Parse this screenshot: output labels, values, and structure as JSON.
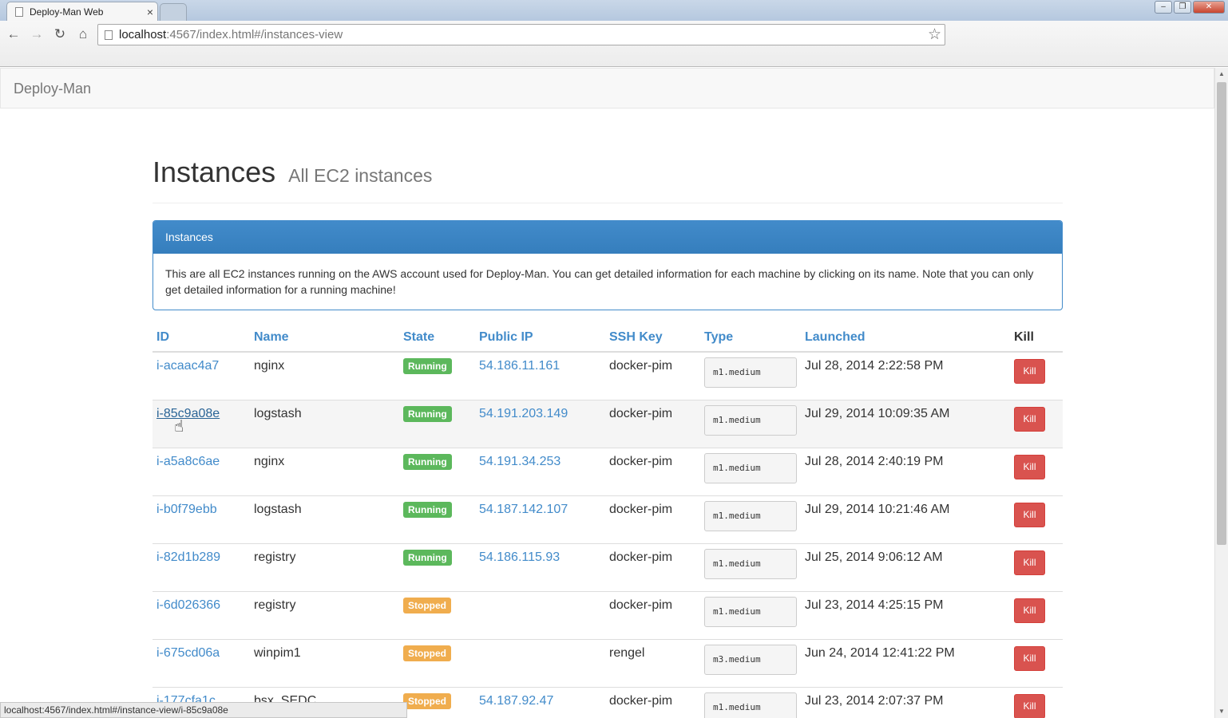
{
  "browser": {
    "tab_title": "Deploy-Man Web",
    "tab_close": "×",
    "url_host": "localhost",
    "url_rest": ":4567/index.html#/instances-view",
    "status_text": "localhost:4567/index.html#/instance-view/i-85c9a08e"
  },
  "navbar": {
    "brand": "Deploy-Man"
  },
  "header": {
    "title": "Instances",
    "subtitle": "All EC2 instances"
  },
  "panel": {
    "heading": "Instances",
    "body": "This are all EC2 instances running on the AWS account used for Deploy-Man. You can get detailed information for each machine by clicking on its name. Note that you can only get detailed information for a running machine!"
  },
  "table": {
    "columns": [
      "ID",
      "Name",
      "State",
      "Public IP",
      "SSH Key",
      "Type",
      "Launched",
      "Kill"
    ],
    "kill_label": "Kill",
    "rows": [
      {
        "id": "i-acaac4a7",
        "name": "nginx",
        "state": "Running",
        "ip": "54.186.11.161",
        "key": "docker-pim",
        "type": "m1.medium",
        "launched": "Jul 28, 2014 2:22:58 PM"
      },
      {
        "id": "i-85c9a08e",
        "name": "logstash",
        "state": "Running",
        "ip": "54.191.203.149",
        "key": "docker-pim",
        "type": "m1.medium",
        "launched": "Jul 29, 2014 10:09:35 AM"
      },
      {
        "id": "i-a5a8c6ae",
        "name": "nginx",
        "state": "Running",
        "ip": "54.191.34.253",
        "key": "docker-pim",
        "type": "m1.medium",
        "launched": "Jul 28, 2014 2:40:19 PM"
      },
      {
        "id": "i-b0f79ebb",
        "name": "logstash",
        "state": "Running",
        "ip": "54.187.142.107",
        "key": "docker-pim",
        "type": "m1.medium",
        "launched": "Jul 29, 2014 10:21:46 AM"
      },
      {
        "id": "i-82d1b289",
        "name": "registry",
        "state": "Running",
        "ip": "54.186.115.93",
        "key": "docker-pim",
        "type": "m1.medium",
        "launched": "Jul 25, 2014 9:06:12 AM"
      },
      {
        "id": "i-6d026366",
        "name": "registry",
        "state": "Stopped",
        "ip": "",
        "key": "docker-pim",
        "type": "m1.medium",
        "launched": "Jul 23, 2014 4:25:15 PM"
      },
      {
        "id": "i-675cd06a",
        "name": "winpim1",
        "state": "Stopped",
        "ip": "",
        "key": "rengel",
        "type": "m3.medium",
        "launched": "Jun 24, 2014 12:41:22 PM"
      },
      {
        "id": "i-177cfa1c",
        "name": "bsx_SEDC",
        "state": "Stopped",
        "ip": "54.187.92.47",
        "key": "docker-pim",
        "type": "m1.medium",
        "launched": "Jul 23, 2014 2:07:37 PM"
      }
    ]
  },
  "colors": {
    "primary": "#428bca",
    "success": "#5cb85c",
    "warning": "#f0ad4e",
    "danger": "#d9534f"
  }
}
